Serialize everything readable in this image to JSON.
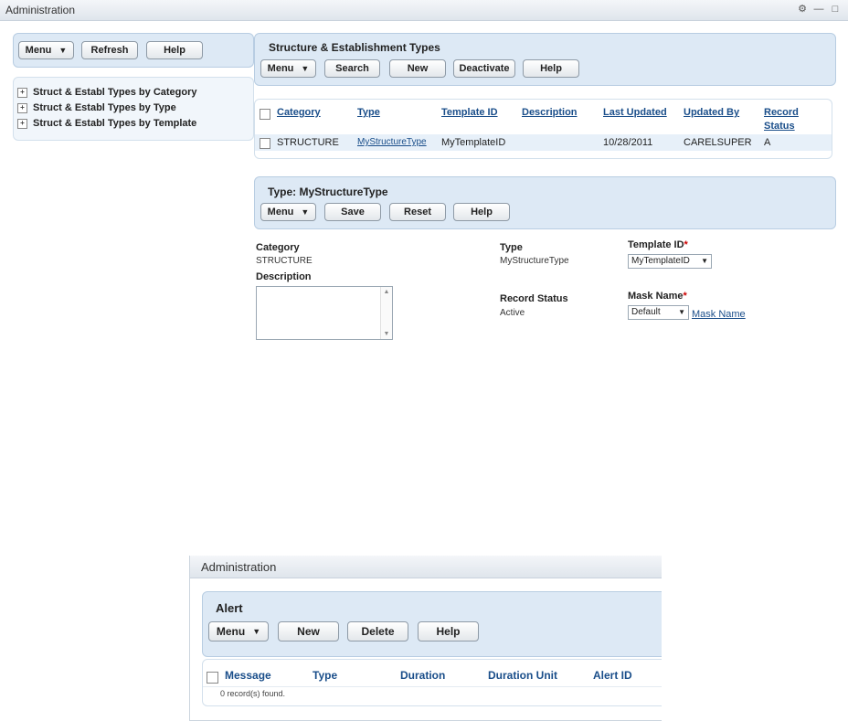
{
  "window": {
    "title": "Administration"
  },
  "left": {
    "toolbar": {
      "menu": "Menu",
      "refresh": "Refresh",
      "help": "Help"
    },
    "tree": [
      "Struct & Establ Types by Category",
      "Struct & Establ Types by Type",
      "Struct & Establ Types by Template"
    ]
  },
  "types_panel": {
    "title": "Structure & Establishment Types",
    "buttons": {
      "menu": "Menu",
      "search": "Search",
      "new": "New",
      "deactivate": "Deactivate",
      "help": "Help"
    }
  },
  "types_table": {
    "headers": [
      "Category",
      "Type",
      "Template ID",
      "Description",
      "Last Updated",
      "Updated By",
      "Record",
      "Status"
    ],
    "rows": [
      {
        "category": "STRUCTURE",
        "type": "MyStructureType",
        "template_id": "MyTemplateID",
        "description": "",
        "last_updated": "10/28/2011",
        "updated_by": "CARELSUPER",
        "status": "A"
      }
    ]
  },
  "detail_panel": {
    "title": "Type: MyStructureType",
    "buttons": {
      "menu": "Menu",
      "save": "Save",
      "reset": "Reset",
      "help": "Help"
    }
  },
  "form": {
    "category_label": "Category",
    "category_value": "STRUCTURE",
    "description_label": "Description",
    "type_label": "Type",
    "type_value": "MyStructureType",
    "record_status_label": "Record Status",
    "record_status_value": "Active",
    "template_id_label": "Template ID",
    "template_id_value": "MyTemplateID",
    "mask_name_label": "Mask Name",
    "mask_name_value": "Default",
    "mask_name_link": "Mask Name",
    "required_mark": "*"
  },
  "window2": {
    "title": "Administration",
    "panel_title": "Alert",
    "buttons": {
      "menu": "Menu",
      "new": "New",
      "delete": "Delete",
      "help": "Help"
    },
    "headers": [
      "Message",
      "Type",
      "Duration",
      "Duration Unit",
      "Alert ID"
    ],
    "empty_text": "0 record(s) found."
  }
}
